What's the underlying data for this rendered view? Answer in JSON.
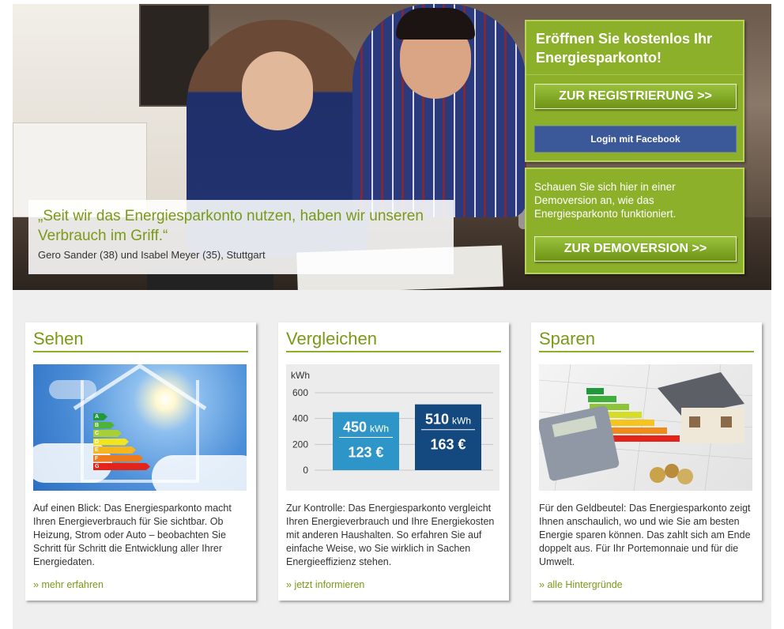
{
  "hero": {
    "quote": "„Seit wir das Energiesparkonto nutzen, haben wir unseren Verbrauch im Griff.“",
    "author": "Gero Sander (38) und Isabel Meyer (35), Stuttgart"
  },
  "signup": {
    "heading": "Eröffnen Sie kostenlos Ihr Energiesparkonto!",
    "register_label": "ZUR REGISTRIERUNG >>",
    "facebook_label": "Login mit Facebook"
  },
  "demo": {
    "text": "Schauen Sie sich hier in einer Demoversion an, wie das Energiesparkonto funktioniert.",
    "button_label": "ZUR DEMOVERSION >>"
  },
  "cards": [
    {
      "title": "Sehen",
      "text": "Auf einen Blick: Das Energiesparkonto macht Ihren Energieverbrauch für Sie sichtbar. Ob Heizung, Strom oder Auto – beobachten Sie Schritt für Schritt die Entwicklung aller Ihrer Energiedaten.",
      "link": "mehr erfahren",
      "energy_labels": [
        "A",
        "B",
        "C",
        "D",
        "E",
        "F",
        "G"
      ]
    },
    {
      "title": "Vergleichen",
      "text": "Zur Kontrolle: Das Energiesparkonto vergleicht Ihren Energieverbrauch und Ihre Energiekosten mit anderen Haushalten. So erfahren Sie auf einfache Weise, wo Sie wirklich in Sachen Energieeffizienz stehen.",
      "link": "jetzt informieren"
    },
    {
      "title": "Sparen",
      "text": "Für den Geldbeutel: Das Energiesparkonto zeigt Ihnen anschaulich, wo und wie Sie am besten Energie sparen können. Das zahlt sich am Ende doppelt aus. Für Ihr Portemonnaie und für die Umwelt.",
      "link": "alle Hintergründe"
    }
  ],
  "link_prefix": "»",
  "chart_data": {
    "type": "bar",
    "ylabel": "kWh",
    "ylim": [
      0,
      600
    ],
    "yticks": [
      600,
      400,
      200,
      0
    ],
    "bars": [
      {
        "value": 450,
        "unit": "kWh",
        "cost": "123 €",
        "color": "#2e95c9"
      },
      {
        "value": 510,
        "unit": "kWh",
        "cost": "163 €",
        "color": "#14497f"
      }
    ]
  },
  "colors": {
    "accent_green": "#8cb02a",
    "text_green": "#7a9a16",
    "facebook_blue": "#3b5998"
  }
}
